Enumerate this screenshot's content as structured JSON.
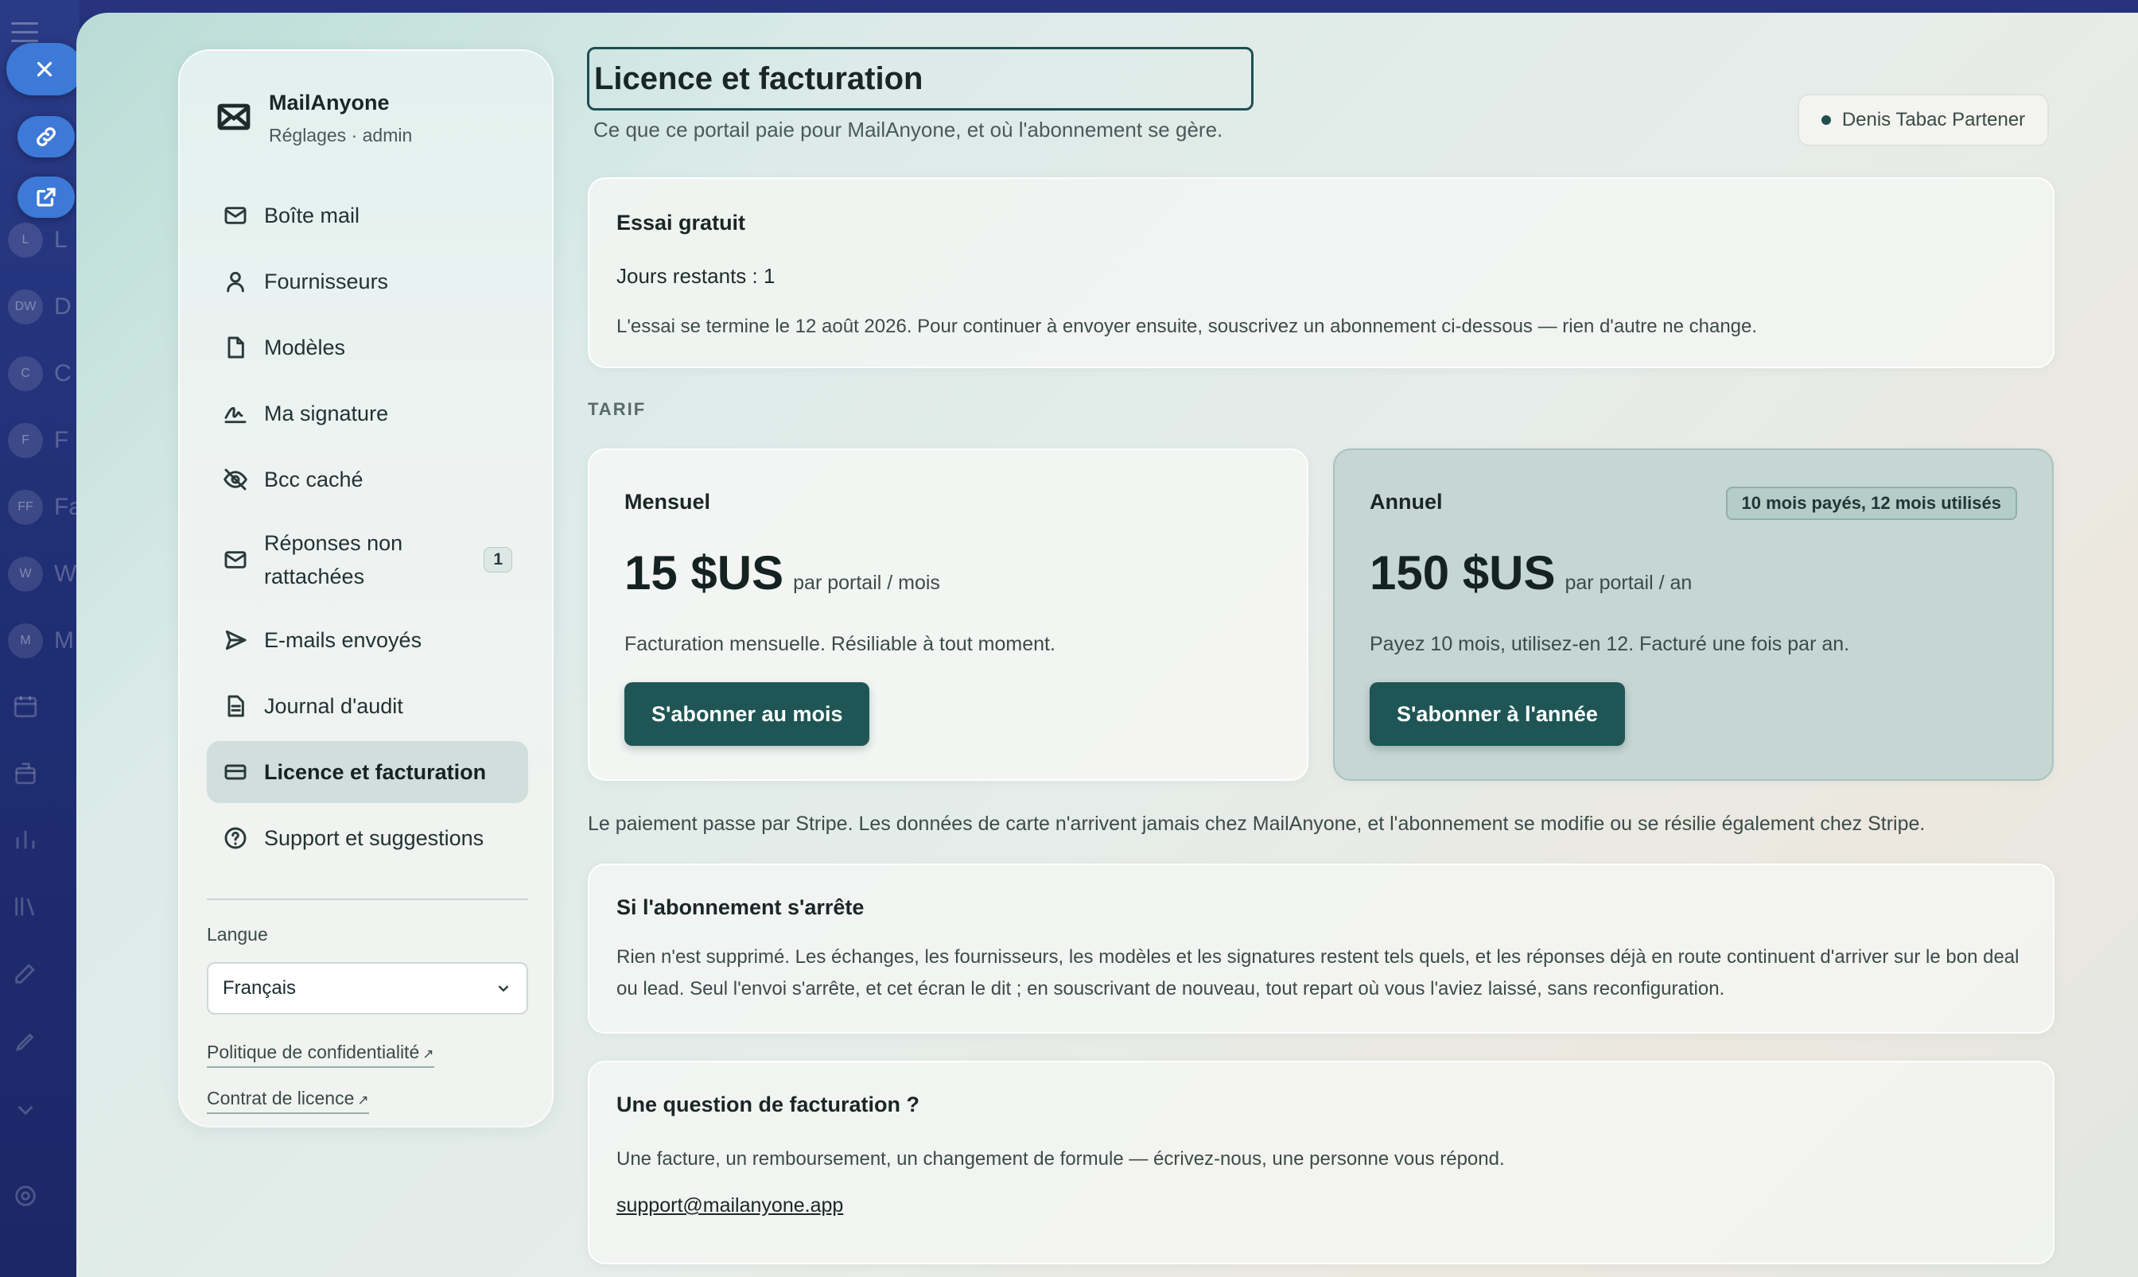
{
  "host": {
    "rows": [
      {
        "avatar": "DW",
        "text": "D"
      },
      {
        "avatar": "C",
        "text": "C"
      },
      {
        "avatar": "F",
        "text": "F"
      },
      {
        "avatar": "FF",
        "text": "Fa"
      },
      {
        "avatar": "W",
        "text": "W"
      },
      {
        "avatar": "M",
        "text": "M"
      },
      {
        "avatar": "L",
        "text": "L"
      }
    ]
  },
  "sidebar": {
    "app_name": "MailAnyone",
    "app_sub": "Réglages · admin",
    "items": [
      {
        "label": "Boîte mail",
        "icon": "mail-icon"
      },
      {
        "label": "Fournisseurs",
        "icon": "user-icon"
      },
      {
        "label": "Modèles",
        "icon": "file-icon"
      },
      {
        "label": "Ma signature",
        "icon": "signature-icon"
      },
      {
        "label": "Bcc caché",
        "icon": "eye-off-icon"
      },
      {
        "label": "Réponses non rattachées",
        "icon": "mail-icon",
        "badge": "1"
      },
      {
        "label": "E-mails envoyés",
        "icon": "send-icon"
      },
      {
        "label": "Journal d'audit",
        "icon": "document-icon"
      },
      {
        "label": "Licence et facturation",
        "icon": "credit-card-icon",
        "active": true
      },
      {
        "label": "Support et suggestions",
        "icon": "help-icon"
      }
    ],
    "language_label": "Langue",
    "language_value": "Français",
    "privacy_link": "Politique de confidentialité",
    "license_link": "Contrat de licence"
  },
  "header": {
    "title": "Licence et facturation",
    "subtitle": "Ce que ce portail paie pour MailAnyone, et où l'abonnement se gère.",
    "user": "Denis Tabac Partener"
  },
  "trial": {
    "title": "Essai gratuit",
    "days": "Jours restants : 1",
    "text": "L'essai se termine le 12 août 2026. Pour continuer à envoyer ensuite, souscrivez un abonnement ci-dessous — rien d'autre ne change."
  },
  "pricing": {
    "section_label": "TARIF",
    "monthly": {
      "name": "Mensuel",
      "amount": "15 $US",
      "per": "par portail / mois",
      "desc": "Facturation mensuelle. Résiliable à tout moment.",
      "button": "S'abonner au mois"
    },
    "annual": {
      "name": "Annuel",
      "tag": "10 mois payés, 12 mois utilisés",
      "amount": "150 $US",
      "per": "par portail / an",
      "desc": "Payez 10 mois, utilisez-en 12. Facturé une fois par an.",
      "button": "S'abonner à l'année"
    }
  },
  "stripe_note": "Le paiement passe par Stripe. Les données de carte n'arrivent jamais chez MailAnyone, et l'abonnement se modifie ou se résilie également chez Stripe.",
  "stop": {
    "title": "Si l'abonnement s'arrête",
    "text": "Rien n'est supprimé. Les échanges, les fournisseurs, les modèles et les signatures restent tels quels, et les réponses déjà en route continuent d'arriver sur le bon deal ou lead. Seul l'envoi s'arrête, et cet écran le dit ; en souscrivant de nouveau, tout repart où vous l'aviez laissé, sans reconfiguration."
  },
  "billing": {
    "title": "Une question de facturation ?",
    "text": "Une facture, un remboursement, un changement de formule — écrivez-nous, une personne vous répond.",
    "email": "support@mailanyone.app"
  }
}
